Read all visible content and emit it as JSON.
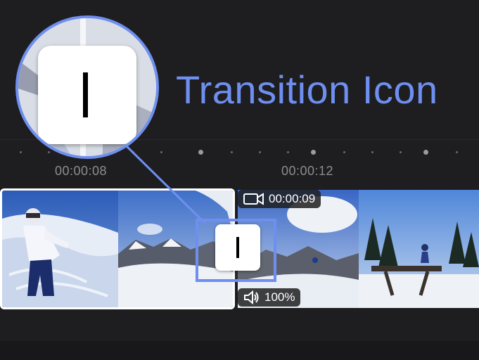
{
  "annotation": {
    "label": "Transition Icon"
  },
  "ruler": {
    "timecodes": [
      "00:00:08",
      "00:00:12"
    ]
  },
  "timeline": {
    "clip_info": {
      "duration": "00:00:09",
      "volume": "100%"
    }
  },
  "icons": {
    "video": "video-camera-icon",
    "volume": "speaker-icon",
    "transition": "transition-icon"
  },
  "colors": {
    "accent": "#6f8ff0",
    "background": "#1e1e20"
  }
}
